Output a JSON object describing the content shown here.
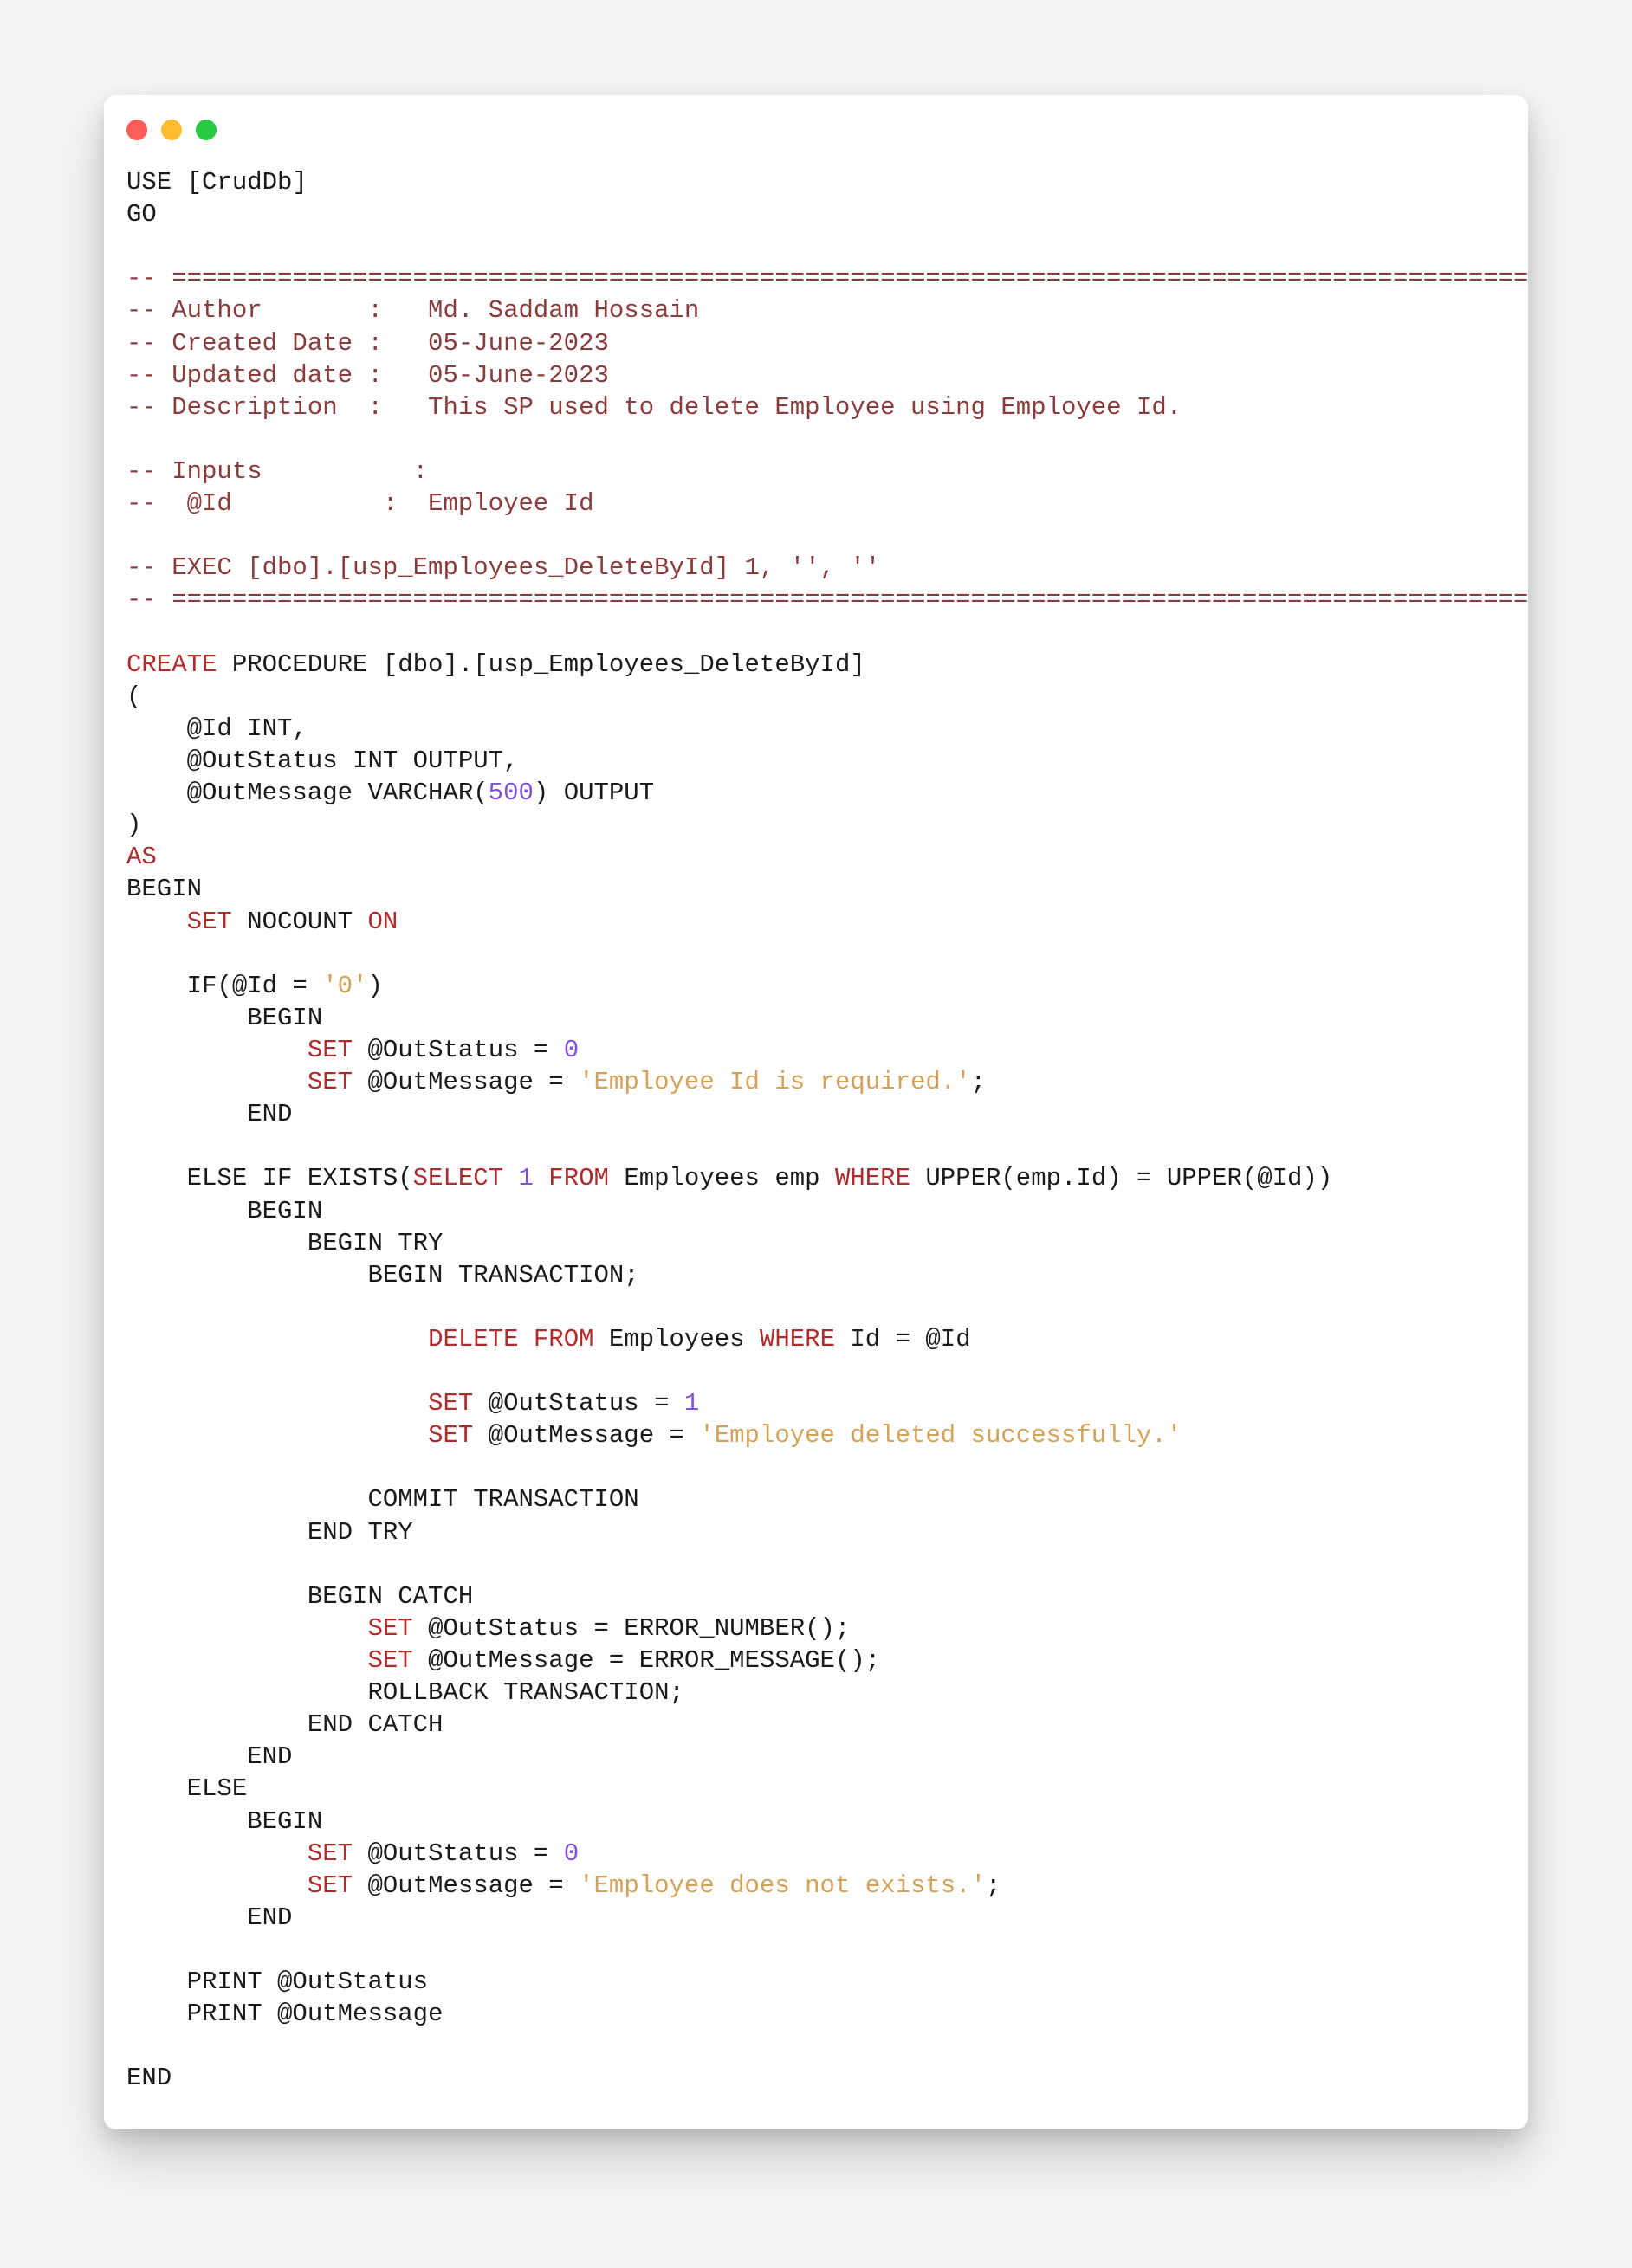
{
  "code": {
    "tokens": [
      {
        "t": "USE [CrudDb]\n"
      },
      {
        "t": "GO\n"
      },
      {
        "t": "\n"
      },
      {
        "cls": "cmt",
        "t": "-- =============================================================================================\n"
      },
      {
        "cls": "cmt",
        "t": "-- Author       :   Md. Saddam Hossain\n"
      },
      {
        "cls": "cmt",
        "t": "-- Created Date :   05-June-2023\n"
      },
      {
        "cls": "cmt",
        "t": "-- Updated date :   05-June-2023\n"
      },
      {
        "cls": "cmt",
        "t": "-- Description  :   This SP used to delete Employee using Employee Id.\n"
      },
      {
        "t": "\n"
      },
      {
        "cls": "cmt",
        "t": "-- Inputs          :\n"
      },
      {
        "cls": "cmt",
        "t": "--  @Id          :  Employee Id\n"
      },
      {
        "t": "\n"
      },
      {
        "cls": "cmt",
        "t": "-- EXEC [dbo].[usp_Employees_DeleteById] 1, '', ''\n"
      },
      {
        "cls": "cmt",
        "t": "-- =============================================================================================\n"
      },
      {
        "t": "\n"
      },
      {
        "cls": "kw",
        "t": "CREATE"
      },
      {
        "t": " PROCEDURE [dbo].[usp_Employees_DeleteById]\n"
      },
      {
        "t": "(\n"
      },
      {
        "t": "    @Id INT,\n"
      },
      {
        "t": "    @OutStatus INT OUTPUT,\n"
      },
      {
        "t": "    @OutMessage VARCHAR("
      },
      {
        "cls": "num",
        "t": "500"
      },
      {
        "t": ") OUTPUT\n"
      },
      {
        "t": ")\n"
      },
      {
        "cls": "kw",
        "t": "AS\n"
      },
      {
        "t": "BEGIN\n"
      },
      {
        "t": "    "
      },
      {
        "cls": "kw",
        "t": "SET"
      },
      {
        "t": " NOCOUNT "
      },
      {
        "cls": "kw",
        "t": "ON"
      },
      {
        "t": "\n"
      },
      {
        "t": "\n"
      },
      {
        "t": "    IF(@Id = "
      },
      {
        "cls": "str",
        "t": "'0'"
      },
      {
        "t": ")\n"
      },
      {
        "t": "        BEGIN\n"
      },
      {
        "t": "            "
      },
      {
        "cls": "kw",
        "t": "SET"
      },
      {
        "t": " @OutStatus = "
      },
      {
        "cls": "num",
        "t": "0"
      },
      {
        "t": "\n"
      },
      {
        "t": "            "
      },
      {
        "cls": "kw",
        "t": "SET"
      },
      {
        "t": " @OutMessage = "
      },
      {
        "cls": "str",
        "t": "'Employee Id is required.'"
      },
      {
        "t": ";\n"
      },
      {
        "t": "        END\n"
      },
      {
        "t": "\n"
      },
      {
        "t": "    ELSE IF EXISTS("
      },
      {
        "cls": "kw",
        "t": "SELECT"
      },
      {
        "t": " "
      },
      {
        "cls": "num",
        "t": "1"
      },
      {
        "t": " "
      },
      {
        "cls": "kw",
        "t": "FROM"
      },
      {
        "t": " Employees emp "
      },
      {
        "cls": "kw",
        "t": "WHERE"
      },
      {
        "t": " UPPER(emp.Id) = UPPER(@Id))\n"
      },
      {
        "t": "        BEGIN\n"
      },
      {
        "t": "            BEGIN TRY\n"
      },
      {
        "t": "                BEGIN TRANSACTION;\n"
      },
      {
        "t": "\n"
      },
      {
        "t": "                    "
      },
      {
        "cls": "kw",
        "t": "DELETE"
      },
      {
        "t": " "
      },
      {
        "cls": "kw",
        "t": "FROM"
      },
      {
        "t": " Employees "
      },
      {
        "cls": "kw",
        "t": "WHERE"
      },
      {
        "t": " Id = @Id\n"
      },
      {
        "t": "\n"
      },
      {
        "t": "                    "
      },
      {
        "cls": "kw",
        "t": "SET"
      },
      {
        "t": " @OutStatus = "
      },
      {
        "cls": "num",
        "t": "1"
      },
      {
        "t": "\n"
      },
      {
        "t": "                    "
      },
      {
        "cls": "kw",
        "t": "SET"
      },
      {
        "t": " @OutMessage = "
      },
      {
        "cls": "str",
        "t": "'Employee deleted successfully.'"
      },
      {
        "t": "\n"
      },
      {
        "t": "\n"
      },
      {
        "t": "                COMMIT TRANSACTION\n"
      },
      {
        "t": "            END TRY\n"
      },
      {
        "t": "\n"
      },
      {
        "t": "            BEGIN CATCH\n"
      },
      {
        "t": "                "
      },
      {
        "cls": "kw",
        "t": "SET"
      },
      {
        "t": " @OutStatus = ERROR_NUMBER();\n"
      },
      {
        "t": "                "
      },
      {
        "cls": "kw",
        "t": "SET"
      },
      {
        "t": " @OutMessage = ERROR_MESSAGE();\n"
      },
      {
        "t": "                ROLLBACK TRANSACTION;\n"
      },
      {
        "t": "            END CATCH\n"
      },
      {
        "t": "        END\n"
      },
      {
        "t": "    ELSE\n"
      },
      {
        "t": "        BEGIN\n"
      },
      {
        "t": "            "
      },
      {
        "cls": "kw",
        "t": "SET"
      },
      {
        "t": " @OutStatus = "
      },
      {
        "cls": "num",
        "t": "0"
      },
      {
        "t": "\n"
      },
      {
        "t": "            "
      },
      {
        "cls": "kw",
        "t": "SET"
      },
      {
        "t": " @OutMessage = "
      },
      {
        "cls": "str",
        "t": "'Employee does not exists.'"
      },
      {
        "t": ";\n"
      },
      {
        "t": "        END\n"
      },
      {
        "t": "\n"
      },
      {
        "t": "    PRINT @OutStatus\n"
      },
      {
        "t": "    PRINT @OutMessage\n"
      },
      {
        "t": "\n"
      },
      {
        "t": "END"
      }
    ]
  }
}
